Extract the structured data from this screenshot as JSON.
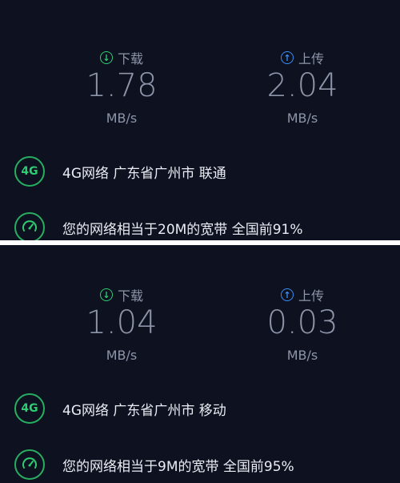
{
  "results": [
    {
      "download": {
        "label": "下载",
        "value": "1.78",
        "unit": "MB/s"
      },
      "upload": {
        "label": "上传",
        "value": "2.04",
        "unit": "MB/s"
      },
      "network": {
        "badge": "4G",
        "text": "4G网络 广东省广州市 联通"
      },
      "comparison": {
        "text": "您的网络相当于20M的宽带 全国前91%"
      }
    },
    {
      "download": {
        "label": "下载",
        "value": "1.04",
        "unit": "MB/s"
      },
      "upload": {
        "label": "上传",
        "value": "0.03",
        "unit": "MB/s"
      },
      "network": {
        "badge": "4G",
        "text": "4G网络 广东省广州市 移动"
      },
      "comparison": {
        "text": "您的网络相当于9M的宽带 全国前95%"
      }
    }
  ],
  "colors": {
    "background": "#0e1120",
    "download_accent": "#2ecc71",
    "upload_accent": "#3a8ef6",
    "muted_text": "#8e95a8",
    "primary_text": "#e9ecf3",
    "divider": "#ffffff"
  },
  "icons": {
    "download": "download-arrow-icon",
    "upload": "upload-arrow-icon",
    "network": "4g-badge-icon",
    "comparison": "speedometer-icon"
  }
}
